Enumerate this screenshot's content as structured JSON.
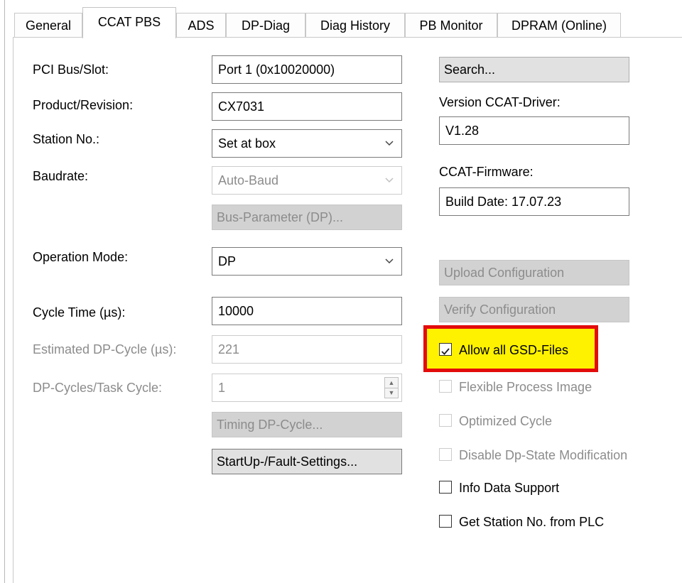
{
  "tabs": [
    "General",
    "CCAT PBS",
    "ADS",
    "DP-Diag",
    "Diag History",
    "PB Monitor",
    "DPRAM (Online)"
  ],
  "active_tab": "CCAT PBS",
  "left": {
    "pci_label": "PCI Bus/Slot:",
    "pci_value": "Port 1 (0x10020000)",
    "product_label": "Product/Revision:",
    "product_value": "CX7031",
    "station_label": "Station No.:",
    "station_value": "Set at box",
    "baud_label": "Baudrate:",
    "baud_value": "Auto-Baud",
    "bus_param_button": "Bus-Parameter (DP)...",
    "opmode_label": "Operation Mode:",
    "opmode_value": "DP",
    "cycle_label": "Cycle Time (µs):",
    "cycle_value": "10000",
    "est_label": "Estimated DP-Cycle (µs):",
    "est_value": "221",
    "dpc_label": "DP-Cycles/Task Cycle:",
    "dpc_value": "1",
    "timing_button": "Timing DP-Cycle...",
    "startup_button": "StartUp-/Fault-Settings..."
  },
  "right": {
    "search_button": "Search...",
    "version_label": "Version CCAT-Driver:",
    "version_value": "V1.28",
    "firmware_label": "CCAT-Firmware:",
    "firmware_value": "Build Date: 17.07.23",
    "upload_button": "Upload Configuration",
    "verify_button": "Verify Configuration"
  },
  "checkboxes": [
    {
      "label": "Allow all GSD-Files",
      "checked": true,
      "enabled": true,
      "highlighted": true
    },
    {
      "label": "Flexible Process Image",
      "checked": false,
      "enabled": false
    },
    {
      "label": "Optimized Cycle",
      "checked": false,
      "enabled": false
    },
    {
      "label": "Disable Dp-State Modification",
      "checked": false,
      "enabled": false
    },
    {
      "label": "Info Data Support",
      "checked": false,
      "enabled": true
    },
    {
      "label": "Get Station No. from PLC",
      "checked": false,
      "enabled": true
    }
  ],
  "colors": {
    "highlight_fill": "#fff200",
    "highlight_border": "#e30c0c",
    "disabled_text": "#8c8c8c"
  }
}
